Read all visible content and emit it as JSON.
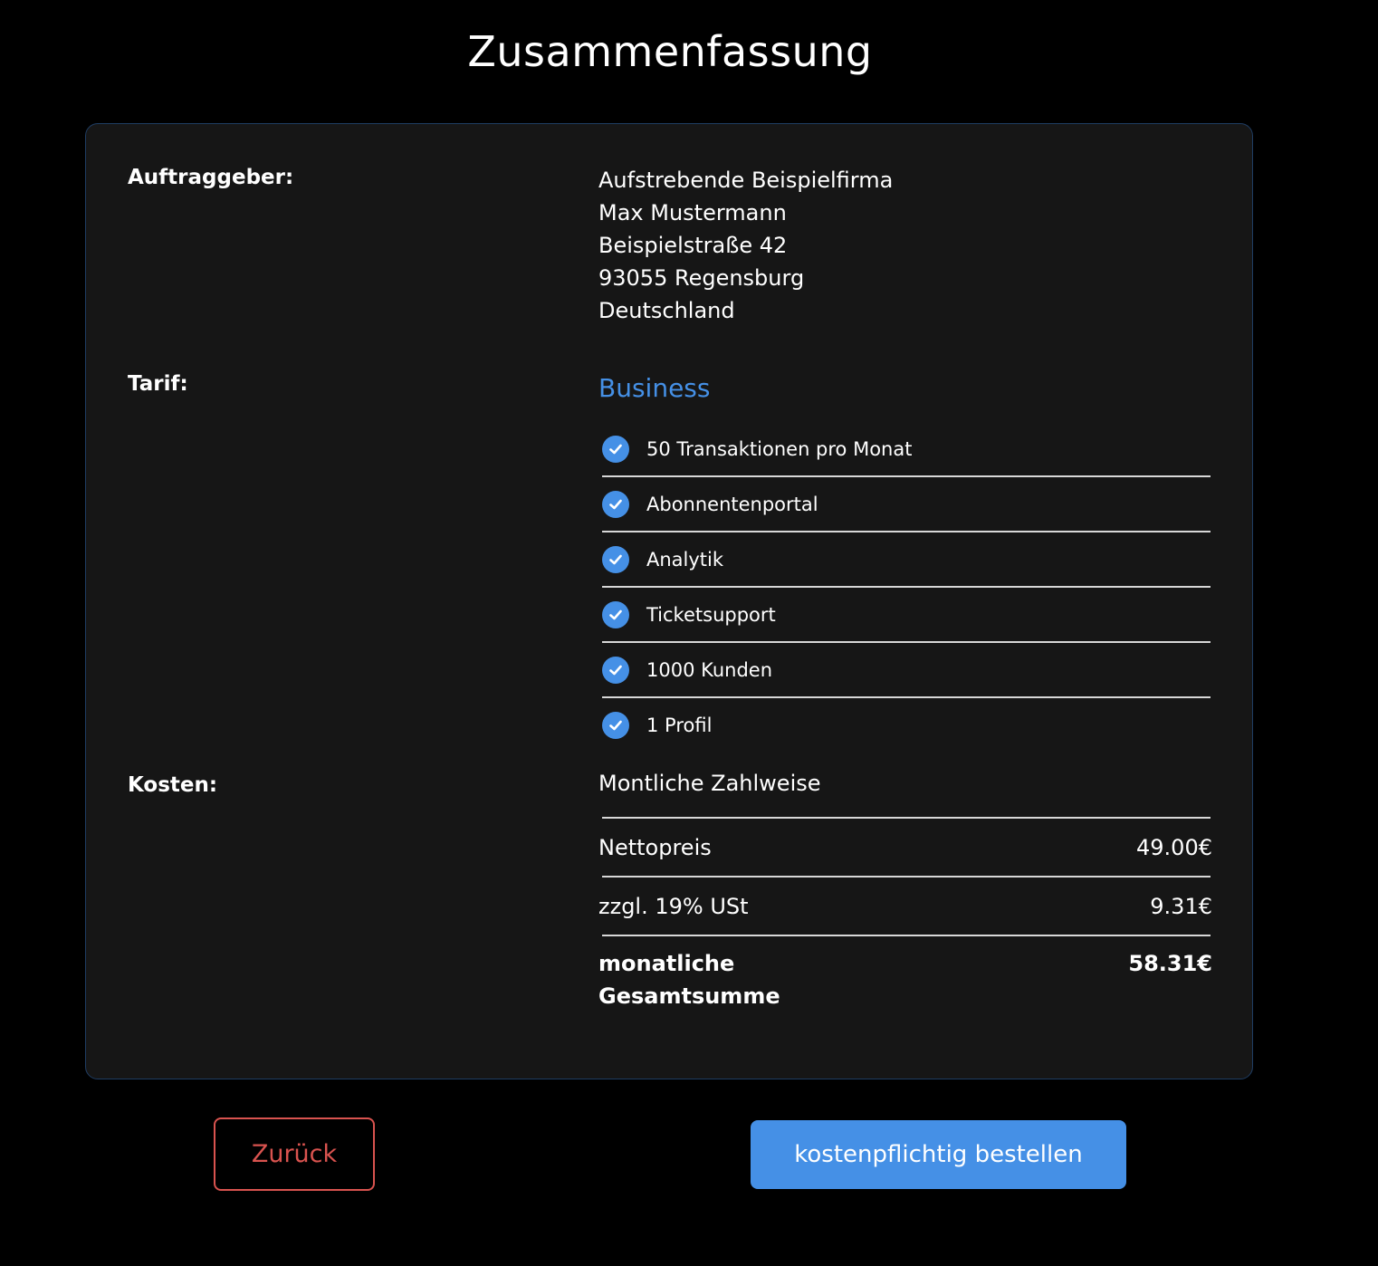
{
  "page": {
    "title": "Zusammenfassung"
  },
  "client": {
    "label": "Auftraggeber:",
    "address": [
      "Aufstrebende Beispielfirma",
      "Max Mustermann",
      "Beispielstraße 42",
      "93055 Regensburg",
      "Deutschland"
    ]
  },
  "tarif": {
    "label": "Tarif:",
    "name": "Business",
    "features": [
      "50 Transaktionen pro Monat",
      "Abonnentenportal",
      "Analytik",
      "Ticketsupport",
      "1000 Kunden",
      "1 Profil"
    ]
  },
  "costs": {
    "label": "Kosten:",
    "payment_mode": "Montliche Zahlweise",
    "net_label": "Nettopreis",
    "net_value": "49.00€",
    "tax_label": "zzgl. 19% USt",
    "tax_value": "9.31€",
    "total_label_line1": "monatliche",
    "total_label_line2": "Gesamtsumme",
    "total_value": "58.31€"
  },
  "actions": {
    "back_label": "Zurück",
    "order_label": "kostenpflichtig bestellen"
  },
  "colors": {
    "accent": "#4590e6",
    "danger": "#d9534f",
    "card_background": "#161616",
    "page_background": "#000000"
  },
  "icons": {
    "feature_icon": "check-circle-icon"
  }
}
